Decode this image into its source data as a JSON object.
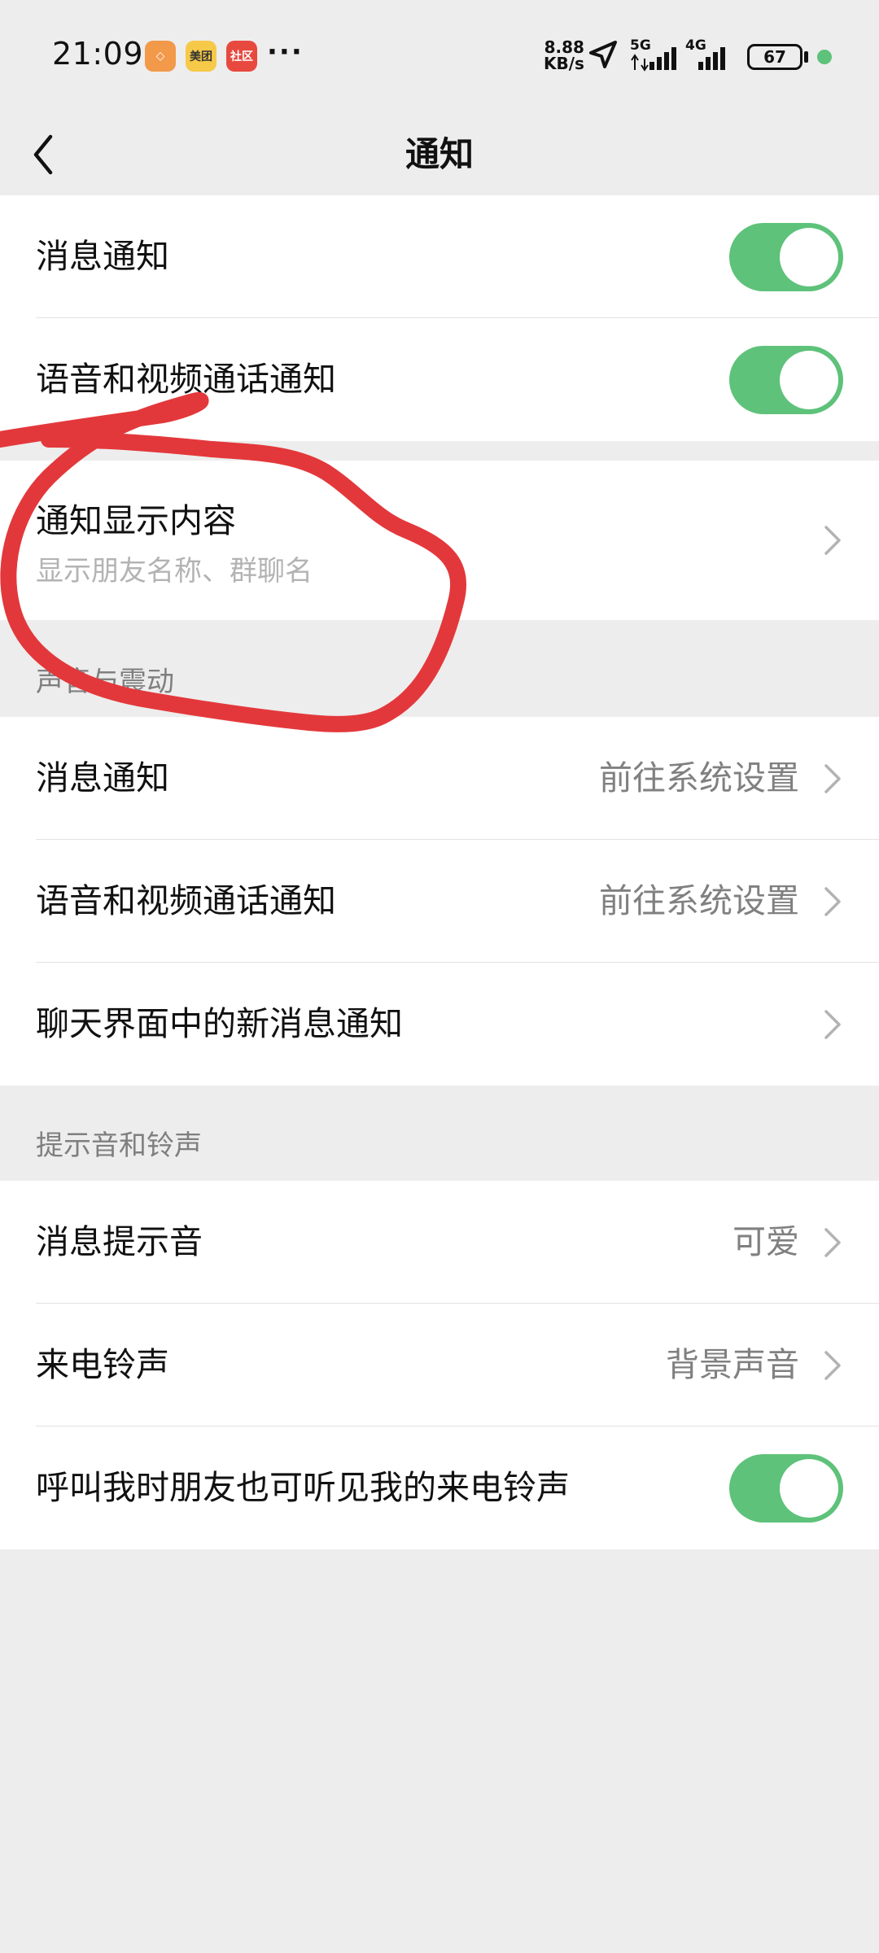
{
  "status_bar": {
    "time": "21:09",
    "apps": [
      {
        "name": "app-icon-orange",
        "color": "#f2994a",
        "glyph": "◇"
      },
      {
        "name": "meituan-icon",
        "color": "#f7c948",
        "glyph": "美团"
      },
      {
        "name": "community-icon",
        "color": "#e8493f",
        "glyph": "社区"
      }
    ],
    "more": "···",
    "net_speed_value": "8.88",
    "net_speed_unit": "KB/s",
    "sig1": "5G",
    "sig2": "4G",
    "battery": "67",
    "dot_color": "#5ec27a"
  },
  "header": {
    "title": "通知"
  },
  "sections": {
    "top": {
      "msg_notify": {
        "label": "消息通知",
        "on": true
      },
      "call_notify": {
        "label": "语音和视频通话通知",
        "on": true
      }
    },
    "display": {
      "title": "通知显示内容",
      "subtitle": "显示朋友名称、群聊名"
    },
    "sound_vibration": {
      "header": "声音与震动",
      "items": [
        {
          "label": "消息通知",
          "value": "前往系统设置"
        },
        {
          "label": "语音和视频通话通知",
          "value": "前往系统设置"
        },
        {
          "label": "聊天界面中的新消息通知",
          "value": ""
        }
      ]
    },
    "tones": {
      "header": "提示音和铃声",
      "items": [
        {
          "label": "消息提示音",
          "value": "可爱"
        },
        {
          "label": "来电铃声",
          "value": "背景声音"
        }
      ],
      "toggle_item": {
        "label": "呼叫我时朋友也可听见我的来电铃声",
        "on": true
      }
    }
  },
  "colors": {
    "toggle_on": "#5ec27a",
    "scribble": "#e3383b",
    "background": "#ededed"
  }
}
